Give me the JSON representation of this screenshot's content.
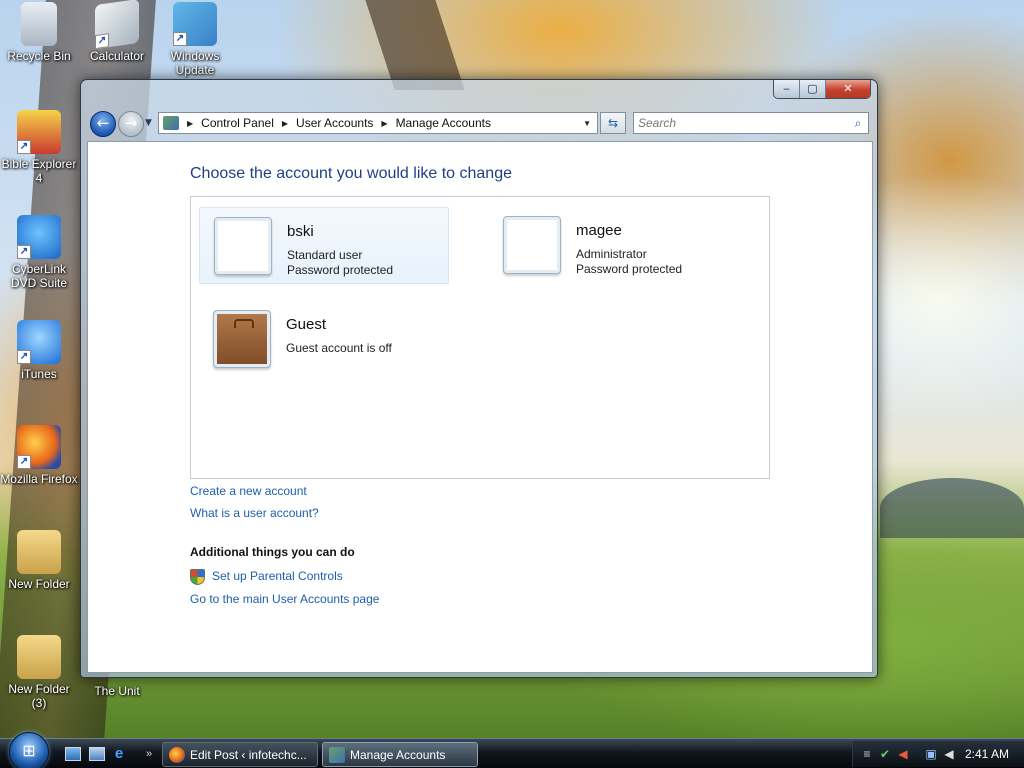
{
  "desktop": {
    "icons": [
      {
        "label": "Recycle Bin",
        "icon": "recycle-bin-icon"
      },
      {
        "label": "Calculator",
        "icon": "calculator-icon"
      },
      {
        "label": "Windows Update",
        "icon": "windows-update-icon"
      },
      {
        "label": "Bible Explorer 4",
        "icon": "bible-explorer-icon"
      },
      {
        "label": "CyberLink DVD Suite",
        "icon": "cyberlink-icon"
      },
      {
        "label": "iTunes",
        "icon": "itunes-icon"
      },
      {
        "label": "Mozilla Firefox",
        "icon": "firefox-icon"
      },
      {
        "label": "New Folder",
        "icon": "folder-icon"
      },
      {
        "label": "New Folder (3)",
        "icon": "folder-icon"
      },
      {
        "label": "The Unit",
        "icon": "folder-icon"
      }
    ]
  },
  "window": {
    "controls": {
      "minimize": "‒",
      "maximize": "▢",
      "close": "✕"
    },
    "breadcrumb": [
      "Control Panel",
      "User Accounts",
      "Manage Accounts"
    ],
    "search_placeholder": "Search"
  },
  "main": {
    "title": "Choose the account you would like to change",
    "accounts": [
      {
        "name": "bski",
        "line1": "Standard user",
        "line2": "Password protected"
      },
      {
        "name": "magee",
        "line1": "Administrator",
        "line2": "Password protected"
      },
      {
        "name": "Guest",
        "line1": "Guest account is off",
        "line2": ""
      }
    ],
    "links": {
      "create_account": "Create a new account",
      "what_is_account": "What is a user account?"
    },
    "additional": {
      "heading": "Additional things you can do",
      "parental_controls": "Set up Parental Controls",
      "main_page": "Go to the main User Accounts page"
    }
  },
  "taskbar": {
    "tasks": [
      {
        "label": "Edit Post ‹ infotechc...",
        "icon": "firefox-icon"
      },
      {
        "label": "Manage Accounts",
        "icon": "user-accounts-icon"
      }
    ],
    "clock": "2:41 AM"
  }
}
